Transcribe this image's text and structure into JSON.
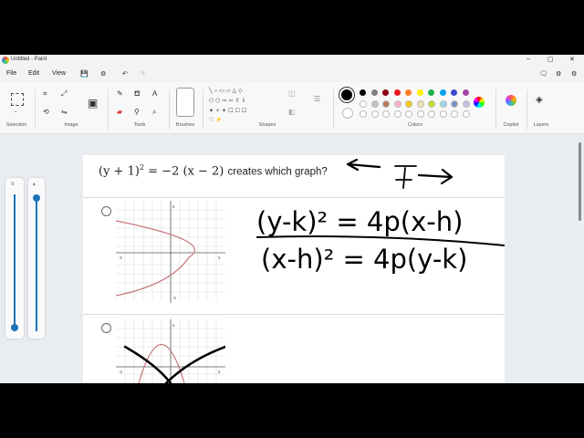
{
  "window": {
    "title": "Untitled - Paint",
    "minimize": "–",
    "maximize": "▢",
    "close": "✕"
  },
  "menu": {
    "file": "File",
    "edit": "Edit",
    "view": "View"
  },
  "ribbon": {
    "groups": {
      "selection": "Selection",
      "image": "Image",
      "tools": "Tools",
      "brushes": "Brushes",
      "shapes": "Shapes",
      "colors": "Colors",
      "copilot": "Copilot",
      "layers": "Layers"
    },
    "colors": [
      "#000000",
      "#7f7f7f",
      "#880015",
      "#ed1c24",
      "#ff7f27",
      "#fff200",
      "#22b14c",
      "#00a2e8",
      "#3f48cc",
      "#a349a4"
    ],
    "colors_row2": [
      "#ffffff",
      "#c3c3c3",
      "#b97a57",
      "#ffaec9",
      "#ffc90e",
      "#efe4b0",
      "#b5e61d",
      "#99d9ea",
      "#7092be",
      "#c8bfe7"
    ]
  },
  "document": {
    "question_lhs": "(y + 1)",
    "question_exp": "2",
    "question_rhs": " = −2 (x − 2)",
    "question_tail": "creates which graph?",
    "handwriting": {
      "line1": "(y-k)² = 4p(x-h)",
      "line2": "(x-h)² = 4p(y-k)"
    },
    "graph1": {
      "tick_neg": "-5",
      "tick_pos": "5",
      "tick_top": "5",
      "tick_bottom": "-5"
    },
    "graph2": {
      "tick_neg": "-5",
      "tick_pos": "5",
      "tick_top": "5"
    }
  }
}
